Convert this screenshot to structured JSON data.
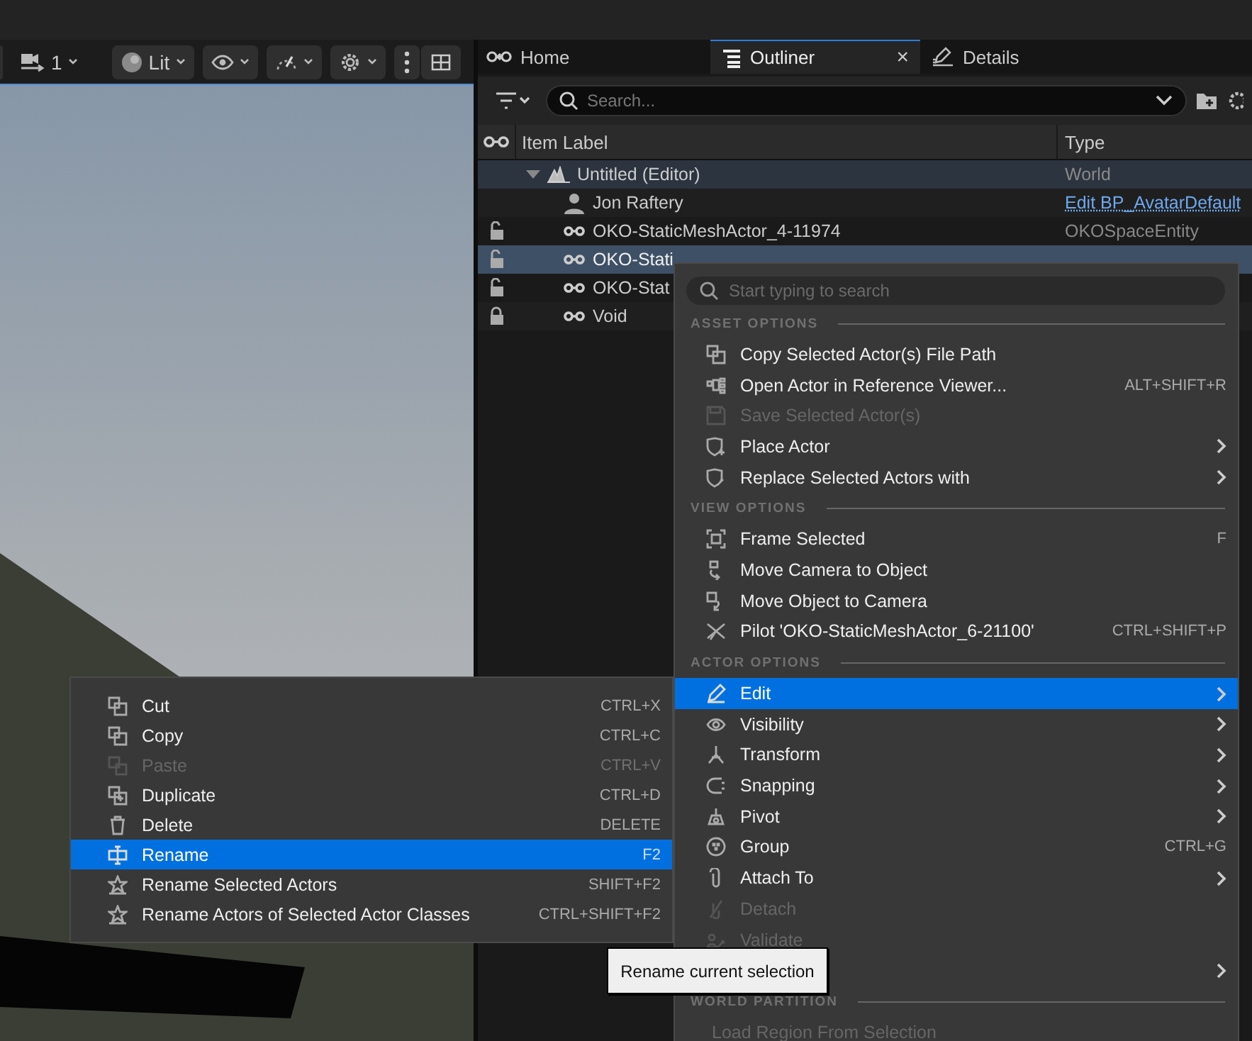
{
  "toolbar": {
    "camera_speed": "1",
    "view_mode": "Lit"
  },
  "tabs": [
    {
      "label": "Home",
      "selected": false
    },
    {
      "label": "Outliner",
      "selected": true,
      "close": "×"
    },
    {
      "label": "Details",
      "selected": false
    }
  ],
  "outliner": {
    "search": {
      "placeholder": "Search..."
    },
    "columns": [
      "Item Label",
      "Type"
    ],
    "rows": [
      {
        "kind": "world",
        "label": "Untitled (Editor)",
        "type": "World",
        "expanded": true,
        "selected": false,
        "children": [
          {
            "kind": "avatar",
            "label": "Jon Raftery",
            "type_link": "Edit BP_AvatarDefault",
            "selected": false
          },
          {
            "kind": "actor",
            "label": "OKO-StaticMeshActor_4-11974",
            "type": "OKOSpaceEntity",
            "locked": false,
            "selected": false
          },
          {
            "kind": "actor",
            "label": "OKO-Stati",
            "locked": false,
            "selected": true
          },
          {
            "kind": "actor",
            "label": "OKO-Stat",
            "locked": false,
            "selected": false
          },
          {
            "kind": "actor",
            "label": "Void",
            "locked": true,
            "selected": false
          }
        ]
      }
    ]
  },
  "edit_menu": {
    "items": [
      {
        "label": "Cut",
        "shortcut": "CTRL+X",
        "disabled": false,
        "selected": false
      },
      {
        "label": "Copy",
        "shortcut": "CTRL+C",
        "disabled": false,
        "selected": false
      },
      {
        "label": "Paste",
        "shortcut": "CTRL+V",
        "disabled": true,
        "selected": false
      },
      {
        "label": "Duplicate",
        "shortcut": "CTRL+D",
        "disabled": false,
        "selected": false
      },
      {
        "label": "Delete",
        "shortcut": "DELETE",
        "disabled": false,
        "selected": false
      },
      {
        "label": "Rename",
        "shortcut": "F2",
        "disabled": false,
        "selected": true
      },
      {
        "label": "Rename Selected Actors",
        "shortcut": "SHIFT+F2",
        "disabled": false,
        "selected": false
      },
      {
        "label": "Rename Actors of Selected Actor Classes",
        "shortcut": "CTRL+SHIFT+F2",
        "disabled": false,
        "selected": false
      }
    ]
  },
  "context_menu": {
    "search": {
      "placeholder": "Start typing to search"
    },
    "sections": [
      {
        "title": "ASSET OPTIONS",
        "items": [
          {
            "label": "Copy Selected Actor(s) File Path",
            "submenu": false,
            "disabled": false,
            "selected": false
          },
          {
            "label": "Open Actor in Reference Viewer...",
            "shortcut": "ALT+SHIFT+R",
            "submenu": false,
            "disabled": false,
            "selected": false
          },
          {
            "label": "Save Selected Actor(s)",
            "submenu": false,
            "disabled": true,
            "selected": false
          },
          {
            "label": "Place Actor",
            "submenu": true,
            "disabled": false,
            "selected": false
          },
          {
            "label": "Replace Selected Actors with",
            "submenu": true,
            "disabled": false,
            "selected": false
          }
        ]
      },
      {
        "title": "VIEW OPTIONS",
        "items": [
          {
            "label": "Frame Selected",
            "shortcut": "F",
            "submenu": false,
            "disabled": false,
            "selected": false
          },
          {
            "label": "Move Camera to Object",
            "submenu": false,
            "disabled": false,
            "selected": false
          },
          {
            "label": "Move Object to Camera",
            "submenu": false,
            "disabled": false,
            "selected": false
          },
          {
            "label": "Pilot 'OKO-StaticMeshActor_6-21100'",
            "shortcut": "CTRL+SHIFT+P",
            "submenu": false,
            "disabled": false,
            "selected": false
          }
        ]
      },
      {
        "title": "ACTOR OPTIONS",
        "items": [
          {
            "label": "Edit",
            "submenu": true,
            "disabled": false,
            "selected": true
          },
          {
            "label": "Visibility",
            "submenu": true,
            "disabled": false,
            "selected": false
          },
          {
            "label": "Transform",
            "submenu": true,
            "disabled": false,
            "selected": false
          },
          {
            "label": "Snapping",
            "submenu": true,
            "disabled": false,
            "selected": false
          },
          {
            "label": "Pivot",
            "submenu": true,
            "disabled": false,
            "selected": false
          },
          {
            "label": "Group",
            "shortcut": "CTRL+G",
            "submenu": false,
            "disabled": false,
            "selected": false
          },
          {
            "label": "Attach To",
            "submenu": true,
            "disabled": false,
            "selected": false
          },
          {
            "label": "Detach",
            "submenu": false,
            "disabled": true,
            "selected": false
          },
          {
            "label": "Validate",
            "submenu": false,
            "disabled": true,
            "selected": false
          },
          {
            "submenu": true,
            "disabled": false,
            "selected": false
          }
        ]
      },
      {
        "title": "WORLD PARTITION",
        "items": [
          {
            "label": "Load Region From Selection",
            "submenu": false,
            "disabled": true,
            "selected": false
          }
        ]
      }
    ]
  },
  "tooltip": "Rename current selection"
}
